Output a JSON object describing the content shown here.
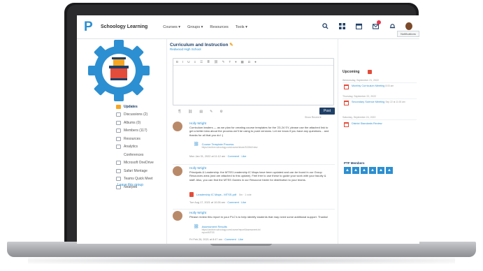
{
  "header": {
    "brand": "Schoology Learning",
    "nav": [
      "Courses",
      "Groups",
      "Resources",
      "Tools"
    ],
    "icons": [
      "search-icon",
      "grid-icon",
      "calendar-icon",
      "messages-icon",
      "bell-icon",
      "user-avatar"
    ]
  },
  "group": {
    "title": "Curriculum and Instruction",
    "subtitle": "Redwood High School"
  },
  "sidebar": {
    "items": [
      {
        "label": "Updates"
      },
      {
        "label": "Discussions (2)"
      },
      {
        "label": "Albums (0)"
      },
      {
        "label": "Members (117)"
      },
      {
        "label": "Resources"
      },
      {
        "label": "Analytics"
      },
      {
        "label": "Conferences"
      },
      {
        "label": "Microsoft OneDrive"
      },
      {
        "label": "Safari Montage"
      },
      {
        "label": "Teams Quick Meet"
      },
      {
        "label": "Nearpod"
      }
    ],
    "leave": "Leave this group"
  },
  "composer": {
    "post_label": "Post",
    "show_recent": "Show Recent"
  },
  "posts": [
    {
      "author": "Holly Wright",
      "body": "Curriculum leaders — as we plan for creating course templates for the '23-24 SY, please use the attached link to get a better idea about the process we'll be using to push versions. Let me know if you have any questions... and thanks for all that you do! :)",
      "link_title": "Course Template Process",
      "link_url": "https://archive.schoology.com/course/share/3130b2/view",
      "meta_date": "Mon Jan 31, 2022 at 11:12 am",
      "comment": "Comment",
      "like": "Like"
    },
    {
      "author": "Holly Wright",
      "body": "Principals & Leadership: the MTSS Leadership IC Maps have been updated and can be found in our Group Resources area (and are attached to this update). Feel free to use these to guide your work with your faculty & staff. Also, you can find the MTSS Guides in our Resource folder for distribution to your teams.",
      "file_title": "Leadership IC Maps - MTSS.pdf",
      "file_meta": "5m · 1 vote",
      "meta_date": "Tue Aug 17, 2021 at 10:26 am",
      "comment": "Comment",
      "like": "Like"
    },
    {
      "author": "Holly Wright",
      "body": "Please review this report in your PLC's to help identify students that may need some additional support. Thanks!",
      "link_title": "Assessment Results",
      "link_url": "https://archive.schoology.com/course/report/Assessment.txt",
      "link_url2": "report/MTSS",
      "meta_date": "Fri Feb 26, 2021 at 8:47 am",
      "comment": "Comment",
      "like": "Like"
    }
  ],
  "upcoming": {
    "title": "Upcoming",
    "notifications": "Notifications",
    "days": [
      {
        "day": "Wednesday, September 21, 2022",
        "event": "Monthly Curriculum Meeting",
        "time": "8:00 am"
      },
      {
        "day": "Thursday, September 22, 2022",
        "event": "Secondary Science Meeting",
        "time": "Sep 22 at 11:00 am"
      },
      {
        "day": "Saturday, September 24, 2022",
        "event": "District Standards Review",
        "time": ""
      }
    ],
    "ptf_title": "PTF Members"
  }
}
